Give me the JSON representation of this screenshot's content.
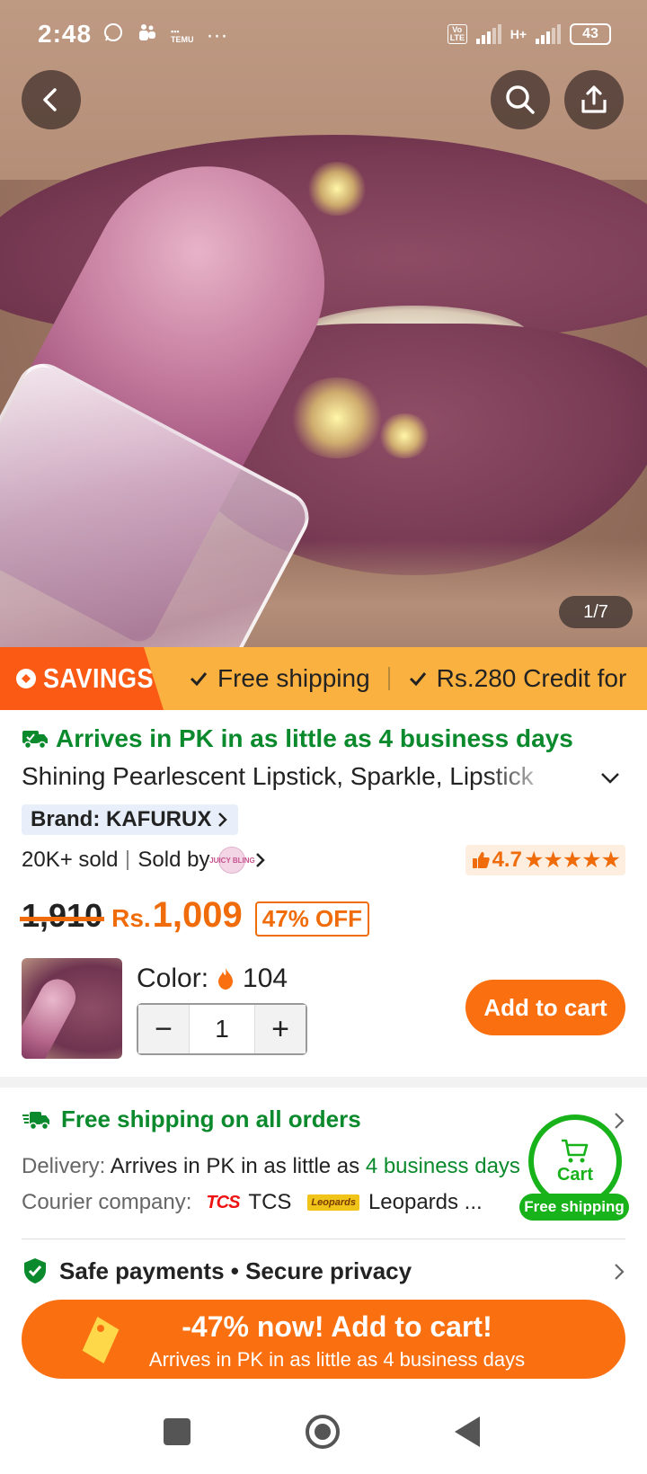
{
  "status_bar": {
    "time": "2:48",
    "network_1": "Vo LTE",
    "network_2": "H+",
    "battery": "43"
  },
  "gallery": {
    "counter": "1/7"
  },
  "savings_banner": {
    "tag": "SAVINGS",
    "items": [
      "Free shipping",
      "Rs.280 Credit for"
    ]
  },
  "product": {
    "arrives": "Arrives in PK in as little as 4 business days",
    "title": "Shining Pearlescent Lipstick, Sparkle, Lipstick",
    "brand": "Brand: KAFURUX",
    "sold": "20K+ sold",
    "sold_by": "Sold by",
    "seller_logo_text": "JUICY BLING",
    "rating": "4.7",
    "stars": "★★★★★",
    "old_price": "1,910",
    "currency": "Rs.",
    "price": "1,009",
    "discount": "47% OFF"
  },
  "variant": {
    "color_label": "Color:",
    "color_count": "104",
    "quantity": "1",
    "minus": "−",
    "plus": "+",
    "add_to_cart": "Add to cart"
  },
  "shipping": {
    "title": "Free shipping on all orders",
    "delivery_label": "Delivery:",
    "delivery_text": "Arrives in PK in as little as",
    "delivery_highlight": "4 business days",
    "courier_label": "Courier company:",
    "tcs_logo": "TCS",
    "tcs_name": "TCS",
    "leopards_logo": "Leopards",
    "leopards_name": "Leopards ..."
  },
  "cart_float": {
    "label": "Cart",
    "pill": "Free shipping"
  },
  "safety": {
    "text": "Safe payments • Secure privacy"
  },
  "cta": {
    "main": "-47% now! Add to cart!",
    "sub": "Arrives in PK in as little as 4 business days"
  },
  "colors": {
    "orange": "#fa6f0f",
    "green": "#0a8a2c",
    "cart_green": "#18b21a",
    "banner_yellow": "#fbb13f",
    "savings_red": "#fa5a14"
  }
}
